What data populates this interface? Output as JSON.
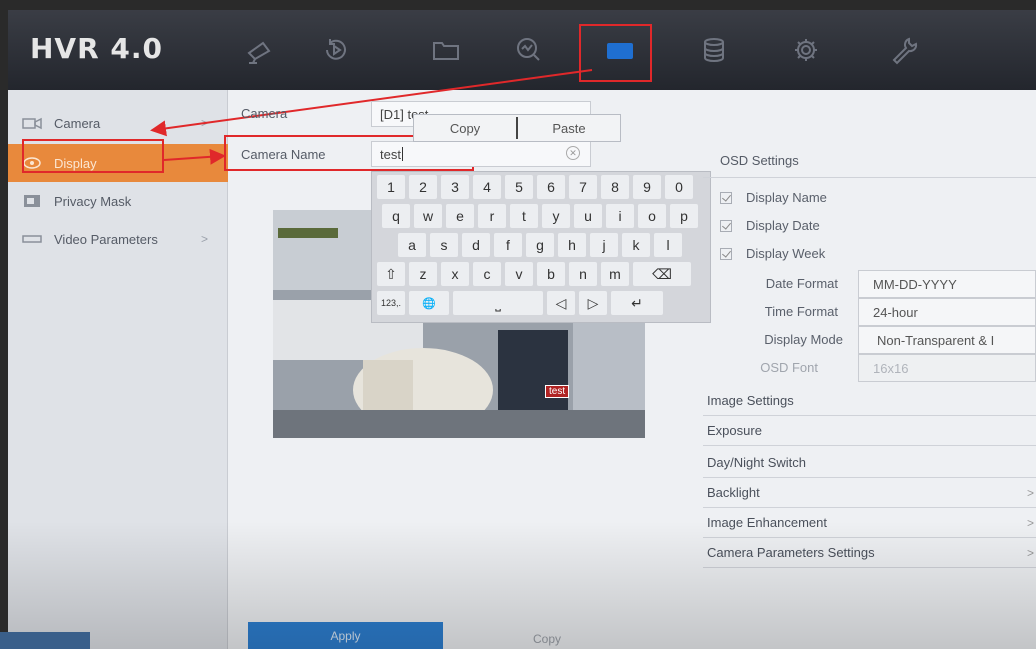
{
  "app": {
    "brand": "HVR 4.0"
  },
  "nav": {
    "icons": [
      "camera-icon",
      "playback-icon",
      "folder-icon",
      "search-icon",
      "video-settings-icon",
      "storage-icon",
      "gear-icon",
      "wrench-icon"
    ],
    "active": "video-settings-icon"
  },
  "sidebar": {
    "items": [
      {
        "label": "Camera",
        "chevron": ">"
      },
      {
        "label": "Display",
        "chevron": ""
      },
      {
        "label": "Privacy Mask",
        "chevron": ""
      },
      {
        "label": "Video Parameters",
        "chevron": ">"
      }
    ]
  },
  "form": {
    "camera_label": "Camera",
    "camera_value": "[D1] test",
    "camera_name_label": "Camera Name",
    "camera_name_value": "test"
  },
  "context_menu": {
    "copy": "Copy",
    "paste": "Paste"
  },
  "keyboard": {
    "row1": [
      "1",
      "2",
      "3",
      "4",
      "5",
      "6",
      "7",
      "8",
      "9",
      "0"
    ],
    "row2": [
      "q",
      "w",
      "e",
      "r",
      "t",
      "y",
      "u",
      "i",
      "o",
      "p"
    ],
    "row3": [
      "a",
      "s",
      "d",
      "f",
      "g",
      "h",
      "j",
      "k",
      "l"
    ],
    "row4": [
      "⇧",
      "z",
      "x",
      "c",
      "v",
      "b",
      "n",
      "m",
      "⌫"
    ],
    "row5": [
      "123,.",
      "🌐",
      "⎵",
      "◁",
      "▷",
      "↵"
    ]
  },
  "preview": {
    "overlay_label": "test"
  },
  "osd": {
    "title": "OSD Settings",
    "display_name": "Display Name",
    "display_date": "Display Date",
    "display_week": "Display Week",
    "date_format_label": "Date Format",
    "date_format_value": "MM-DD-YYYY",
    "time_format_label": "Time Format",
    "time_format_value": "24-hour",
    "display_mode_label": "Display Mode",
    "display_mode_value": "Non-Transparent & I",
    "osd_font_label": "OSD Font",
    "osd_font_value": "16x16"
  },
  "sections": [
    {
      "label": "Image Settings",
      "chevron": ""
    },
    {
      "label": "Exposure",
      "chevron": ""
    },
    {
      "label": "Day/Night Switch",
      "chevron": ""
    },
    {
      "label": "Backlight",
      "chevron": ">"
    },
    {
      "label": "Image Enhancement",
      "chevron": ">"
    },
    {
      "label": "Camera Parameters Settings",
      "chevron": ">"
    }
  ],
  "buttons": {
    "apply": "Apply",
    "copy": "Copy"
  },
  "colors": {
    "accent": "#e8893c",
    "apply": "#2d7fd1",
    "annotation": "#e0282a"
  }
}
